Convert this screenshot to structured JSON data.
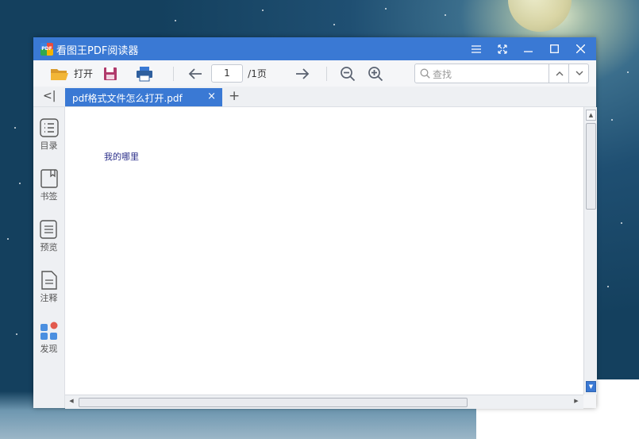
{
  "window": {
    "title": "看图王PDF阅读器",
    "app_icon_text": "PDF"
  },
  "toolbar": {
    "open_label": "打开",
    "page_current": "1",
    "page_total": "/1页",
    "search_placeholder": "查找"
  },
  "tabs": [
    {
      "label": "pdf格式文件怎么打开.pdf",
      "close": "×"
    }
  ],
  "new_tab": "+",
  "sidebar": {
    "collapse": "<|",
    "items": [
      {
        "label": "目录",
        "icon": "list-icon"
      },
      {
        "label": "书签",
        "icon": "bookmark-icon"
      },
      {
        "label": "预览",
        "icon": "pages-icon"
      },
      {
        "label": "注释",
        "icon": "note-icon"
      },
      {
        "label": "发现",
        "icon": "apps-icon"
      }
    ]
  },
  "document": {
    "text": "我的哪里"
  },
  "colors": {
    "accent": "#3a79d4",
    "panel": "#eef0f3"
  }
}
